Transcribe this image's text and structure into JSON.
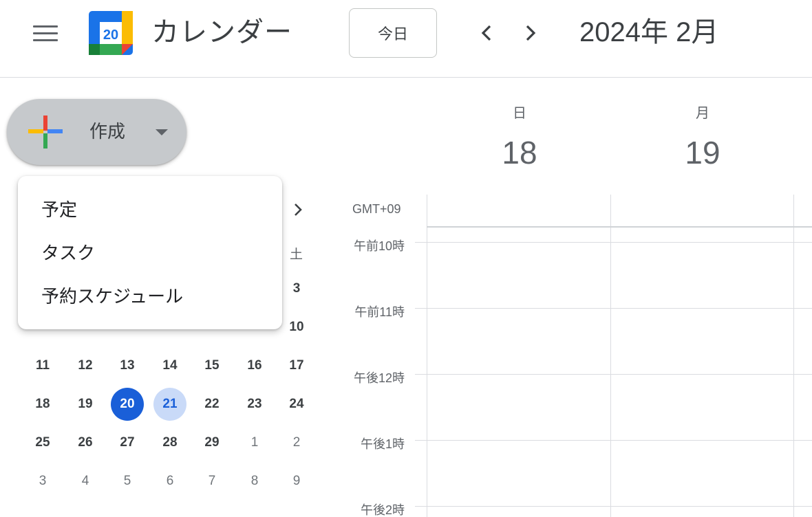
{
  "header": {
    "app_title": "カレンダー",
    "logo_day": "20",
    "today_label": "今日",
    "current_month": "2024年 2月"
  },
  "create": {
    "label": "作成"
  },
  "menu": {
    "items": [
      "予定",
      "タスク",
      "予約スケジュール"
    ]
  },
  "mini_calendar": {
    "weekday_visible": "土",
    "rows": [
      [
        {
          "d": "3",
          "other": false
        }
      ],
      [
        {
          "d": "10",
          "other": false
        }
      ],
      [
        {
          "d": "11",
          "other": false
        },
        {
          "d": "12",
          "other": false
        },
        {
          "d": "13",
          "other": false
        },
        {
          "d": "14",
          "other": false
        },
        {
          "d": "15",
          "other": false
        },
        {
          "d": "16",
          "other": false
        },
        {
          "d": "17",
          "other": false
        }
      ],
      [
        {
          "d": "18",
          "other": false
        },
        {
          "d": "19",
          "other": false
        },
        {
          "d": "20",
          "other": false,
          "selected": true
        },
        {
          "d": "21",
          "other": false,
          "today": true
        },
        {
          "d": "22",
          "other": false
        },
        {
          "d": "23",
          "other": false
        },
        {
          "d": "24",
          "other": false
        }
      ],
      [
        {
          "d": "25",
          "other": false
        },
        {
          "d": "26",
          "other": false
        },
        {
          "d": "27",
          "other": false
        },
        {
          "d": "28",
          "other": false
        },
        {
          "d": "29",
          "other": false
        },
        {
          "d": "1",
          "other": true
        },
        {
          "d": "2",
          "other": true
        }
      ],
      [
        {
          "d": "3",
          "other": true
        },
        {
          "d": "4",
          "other": true
        },
        {
          "d": "5",
          "other": true
        },
        {
          "d": "6",
          "other": true
        },
        {
          "d": "7",
          "other": true
        },
        {
          "d": "8",
          "other": true
        },
        {
          "d": "9",
          "other": true
        }
      ]
    ]
  },
  "week": {
    "days": [
      {
        "dow": "日",
        "num": "18"
      },
      {
        "dow": "月",
        "num": "19"
      }
    ],
    "timezone": "GMT+09",
    "hours": [
      "午前10時",
      "午前11時",
      "午後12時",
      "午後1時",
      "午後2時"
    ]
  },
  "colors": {
    "blue": "#1a5fd8",
    "today_bg": "#c9daf8",
    "create_bg": "#c6c9cc"
  }
}
